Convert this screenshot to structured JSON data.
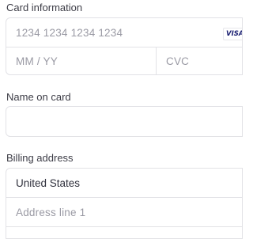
{
  "card": {
    "label": "Card information",
    "number_placeholder": "1234 1234 1234 1234",
    "brand_icon_label": "VISA",
    "expiry_placeholder": "MM / YY",
    "cvc_placeholder": "CVC"
  },
  "name": {
    "label": "Name on card",
    "value": ""
  },
  "billing": {
    "label": "Billing address",
    "country_value": "United States",
    "address_line1_placeholder": "Address line 1"
  },
  "icons": {
    "card_brand": "visa-icon"
  },
  "colors": {
    "border": "#e2e2e6",
    "placeholder": "#9a9aa4",
    "text": "#30313d",
    "visa": "#1a1f71"
  }
}
